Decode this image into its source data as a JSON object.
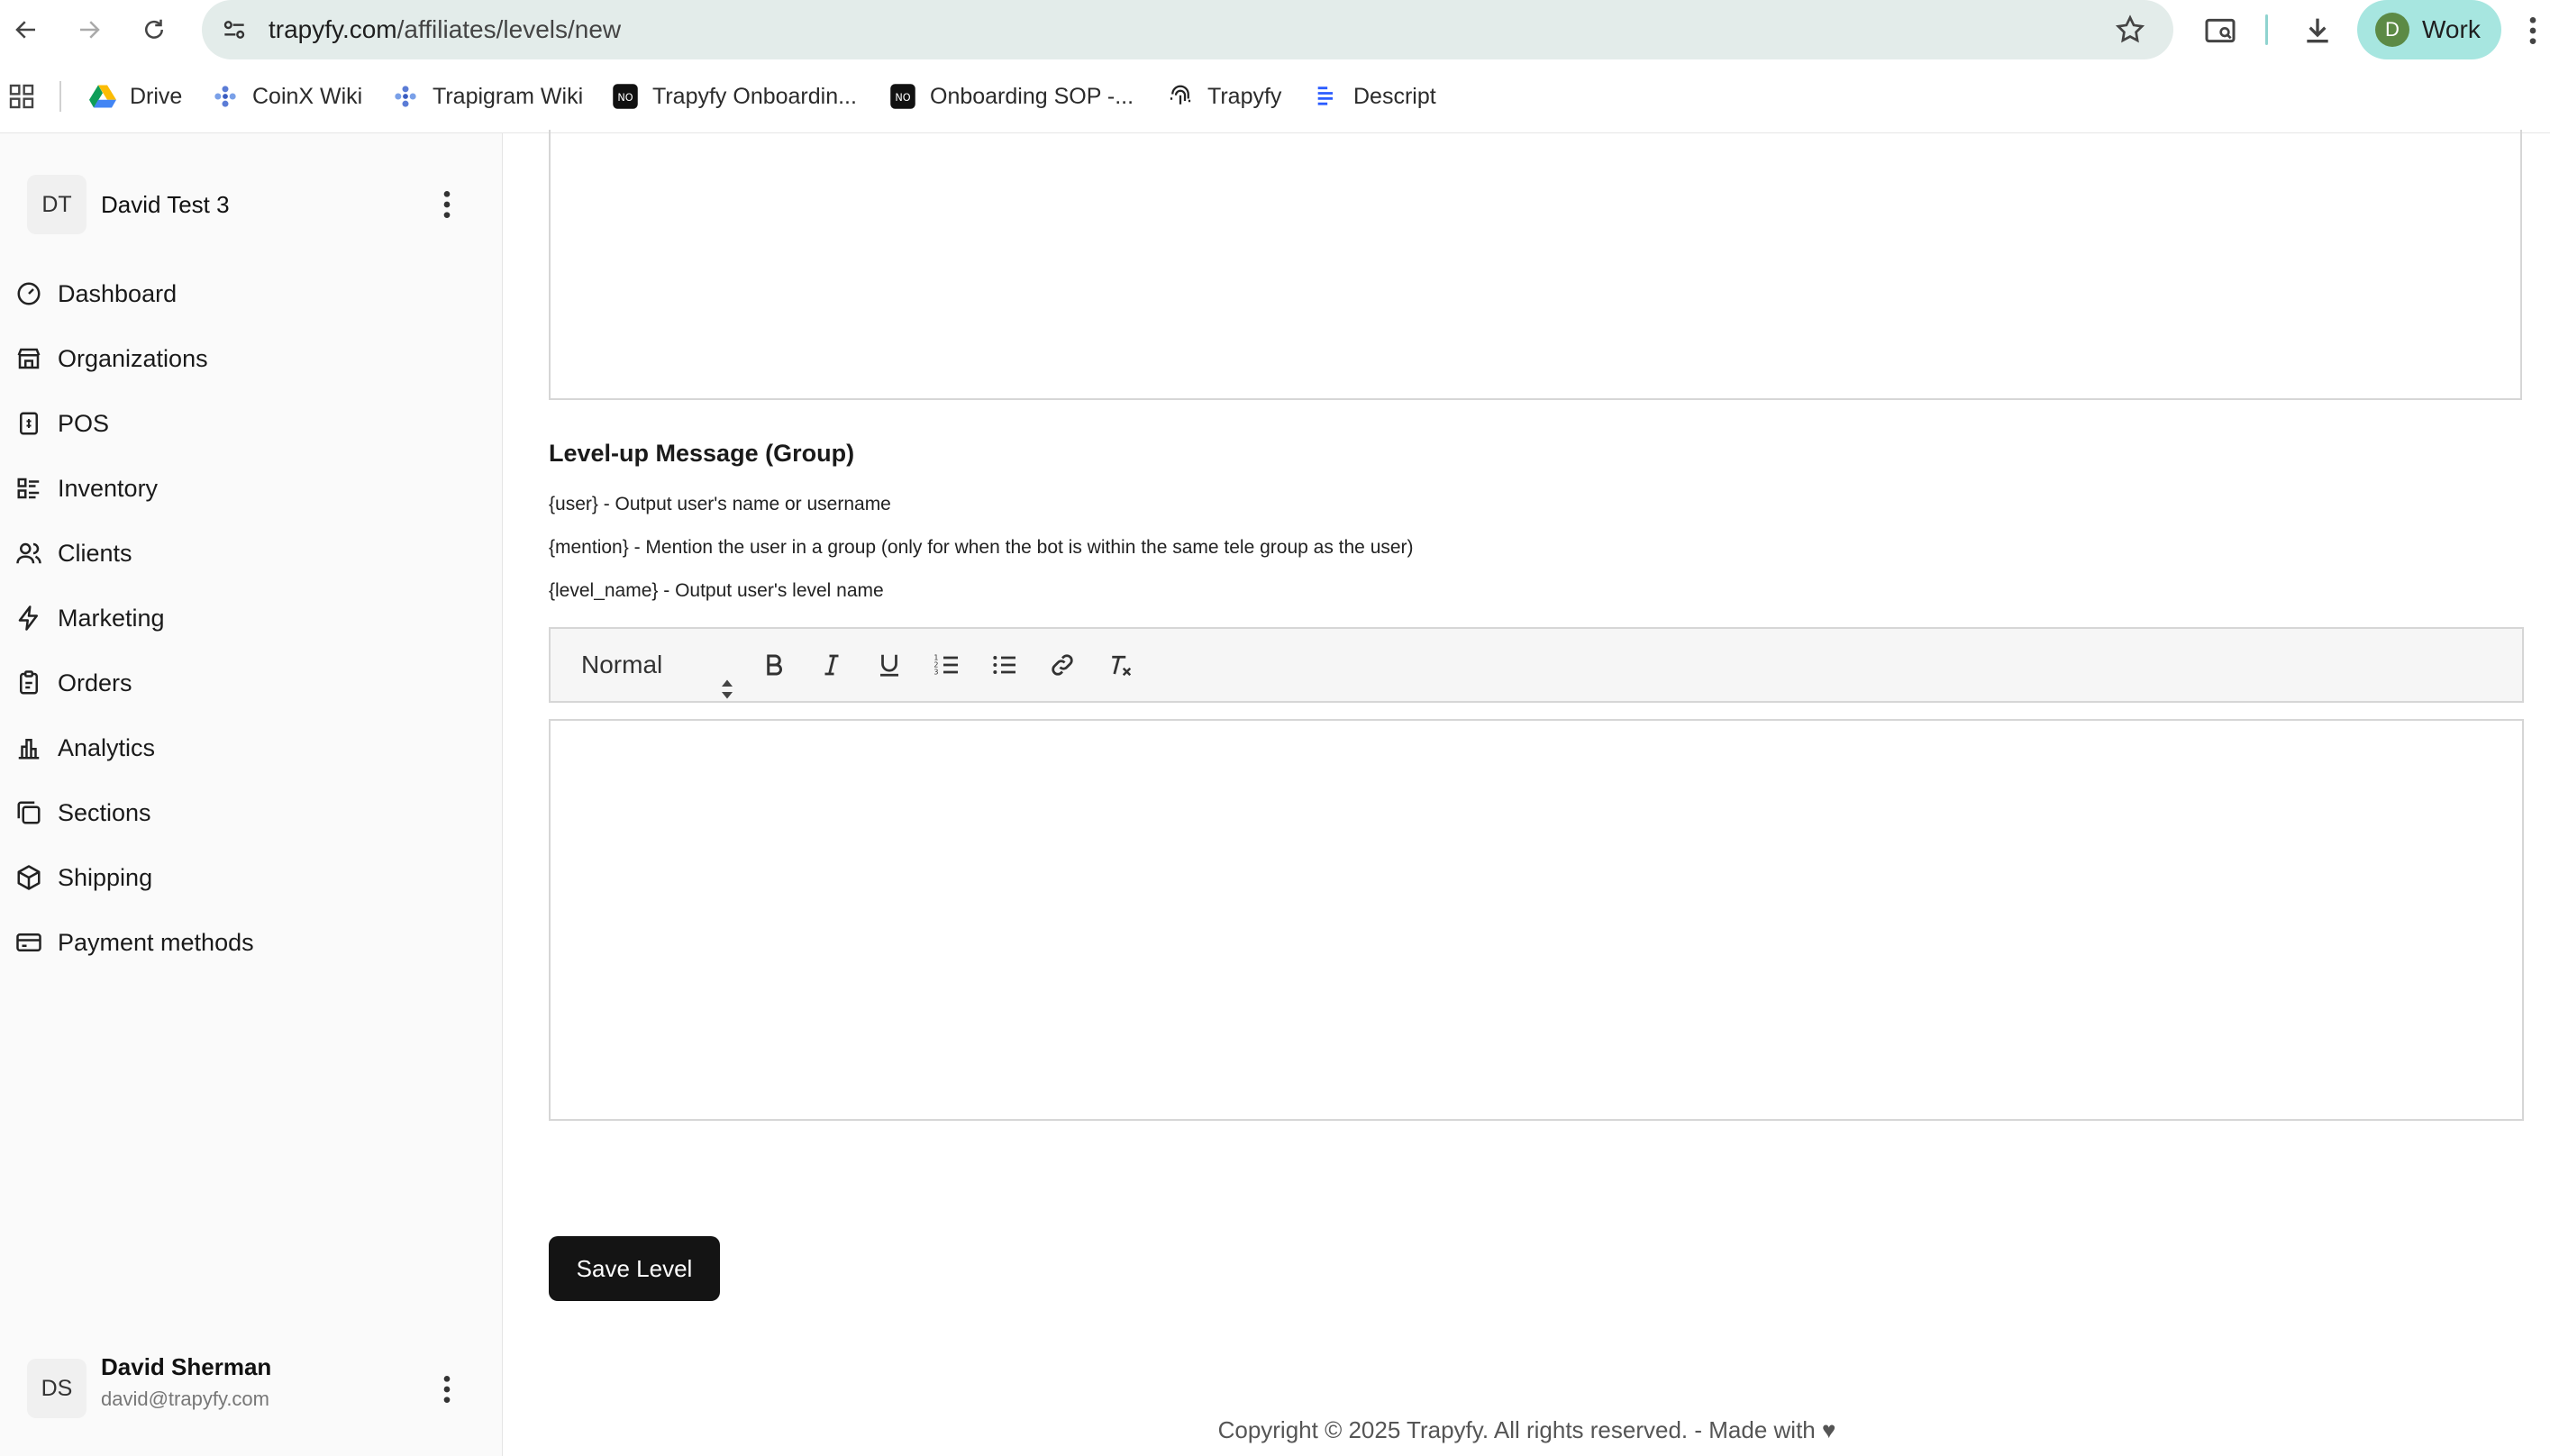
{
  "browser": {
    "url_host": "trapyfy.com",
    "url_path": "/affiliates/levels/new",
    "profile_initial": "D",
    "profile_label": "Work",
    "accent": "#a7e6e0"
  },
  "bookmarks": [
    {
      "label": "Drive",
      "icon": "google-drive-icon"
    },
    {
      "label": "CoinX Wiki",
      "icon": "wiki-icon"
    },
    {
      "label": "Trapigram Wiki",
      "icon": "wiki-icon"
    },
    {
      "label": "Trapyfy Onboardin...",
      "icon": "notion-icon"
    },
    {
      "label": "Onboarding SOP -...",
      "icon": "notion-icon"
    },
    {
      "label": "Trapyfy",
      "icon": "fingerprint-icon"
    },
    {
      "label": "Descript",
      "icon": "descript-icon"
    }
  ],
  "sidebar": {
    "org": {
      "initials": "DT",
      "name": "David Test 3"
    },
    "items": [
      {
        "label": "Dashboard",
        "icon": "dashboard-icon"
      },
      {
        "label": "Organizations",
        "icon": "store-icon"
      },
      {
        "label": "POS",
        "icon": "pos-icon"
      },
      {
        "label": "Inventory",
        "icon": "inventory-icon"
      },
      {
        "label": "Clients",
        "icon": "users-icon"
      },
      {
        "label": "Marketing",
        "icon": "bolt-icon"
      },
      {
        "label": "Orders",
        "icon": "orders-icon"
      },
      {
        "label": "Analytics",
        "icon": "analytics-icon"
      },
      {
        "label": "Sections",
        "icon": "sections-icon"
      },
      {
        "label": "Shipping",
        "icon": "shipping-icon"
      },
      {
        "label": "Payment methods",
        "icon": "payment-icon"
      }
    ],
    "user": {
      "initials": "DS",
      "name": "David Sherman",
      "email": "david@trapyfy.com"
    }
  },
  "main": {
    "section_title": "Level-up Message (Group)",
    "help_lines": [
      "{user} - Output user's name or username",
      "{mention} - Mention the user in a group (only for when the bot is within the same tele group as the user)",
      "{level_name} - Output user's level name"
    ],
    "toolbar": {
      "format_value": "Normal"
    },
    "save_label": "Save Level",
    "footer": "Copyright © 2025 Trapyfy. All rights reserved. - Made with ♥"
  }
}
